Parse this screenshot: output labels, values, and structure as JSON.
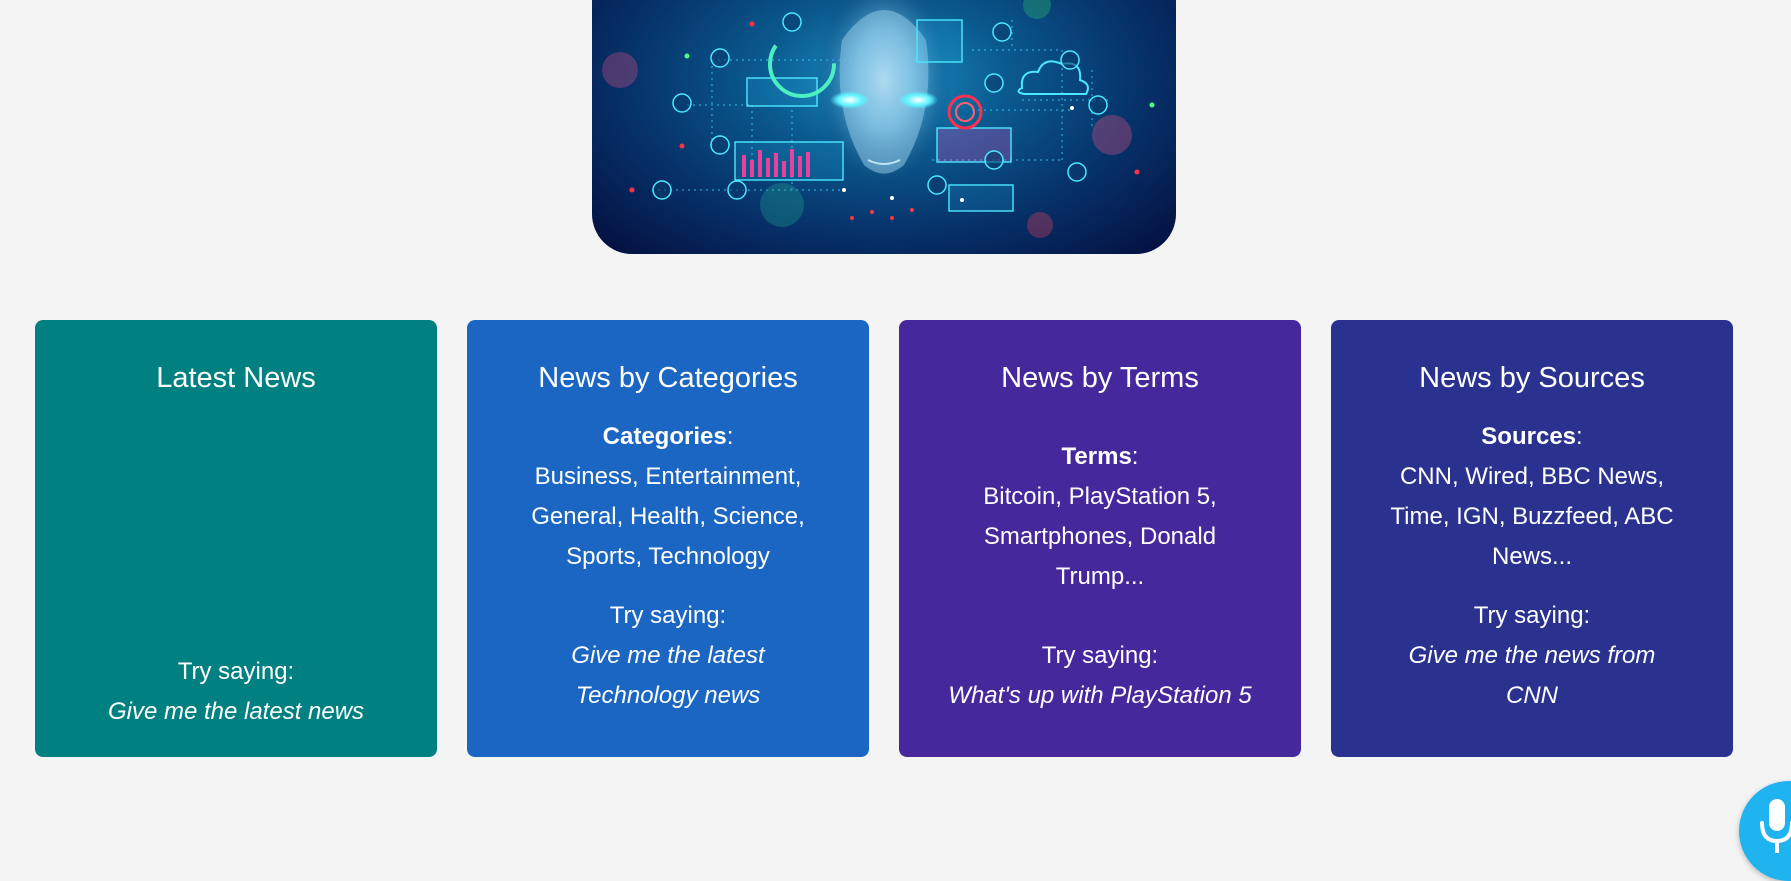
{
  "hero": {
    "image_name": "ai-robot-face-banner"
  },
  "cards": [
    {
      "title": "Latest News",
      "try_label": "Try saying:",
      "example": "Give me the latest news",
      "color": "#008080"
    },
    {
      "title": "News by Categories",
      "info_label": "Categories",
      "info_sep": ":",
      "info_text": "Business, Entertainment, General, Health, Science, Sports, Technology",
      "try_label": "Try saying:",
      "example": "Give me the latest Technology news",
      "color": "#1a66c2"
    },
    {
      "title": "News by Terms",
      "info_label": "Terms",
      "info_sep": ":",
      "info_text": "Bitcoin, PlayStation 5, Smartphones, Donald Trump...",
      "try_label": "Try saying:",
      "example": "What's up with PlayStation 5",
      "color": "#45289c"
    },
    {
      "title": "News by Sources",
      "info_label": "Sources",
      "info_sep": ":",
      "info_text": "CNN, Wired, BBC News, Time, IGN, Buzzfeed, ABC News...",
      "try_label": "Try saying:",
      "example": "Give me the news from CNN",
      "color": "#2a318f"
    }
  ],
  "mic_button": {
    "icon": "microphone-icon",
    "color": "#1fb3f0"
  }
}
